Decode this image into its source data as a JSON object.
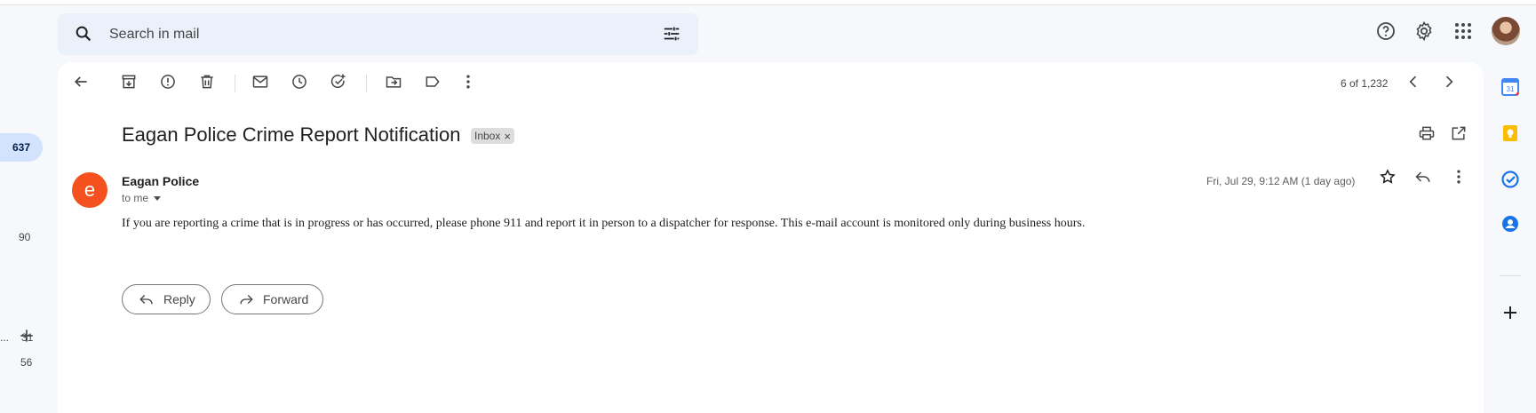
{
  "search": {
    "placeholder": "Search in mail"
  },
  "rail": {
    "selected_count": "637",
    "counts": [
      "90",
      "31",
      "56"
    ],
    "ellipsis": "..."
  },
  "toolbar": {
    "pager": "6 of 1,232"
  },
  "email": {
    "subject": "Eagan Police Crime Report Notification",
    "label": "Inbox",
    "label_remove": "×",
    "sender_initial": "e",
    "sender_name": "Eagan Police",
    "recipient": "to me",
    "date": "Fri, Jul 29, 9:12 AM (1 day ago)",
    "body": "If you are reporting a crime that is in progress or has occurred, please phone 911 and report it in person to a dispatcher for response.  This e-mail account is monitored only during business hours."
  },
  "actions": {
    "reply_label": "Reply",
    "forward_label": "Forward"
  },
  "side_panel": {
    "calendar_day": "31"
  },
  "colors": {
    "accent": "#0b57d0",
    "sender_avatar": "#f4511e",
    "selected_pill": "#d3e3fd",
    "search_bg": "#eaf1fb",
    "page_bg": "#f6f8fc"
  },
  "icons": [
    "search-icon",
    "filter-icon",
    "help-icon",
    "settings-icon",
    "apps-icon",
    "back-icon",
    "archive-icon",
    "report-spam-icon",
    "delete-icon",
    "mark-unread-icon",
    "snooze-icon",
    "add-task-icon",
    "move-to-icon",
    "label-icon",
    "more-icon",
    "prev-icon",
    "next-icon",
    "print-icon",
    "open-in-new-window-icon",
    "star-icon",
    "reply-icon",
    "forward-icon",
    "calendar-icon",
    "keep-icon",
    "tasks-icon",
    "contacts-icon",
    "add-icon"
  ]
}
